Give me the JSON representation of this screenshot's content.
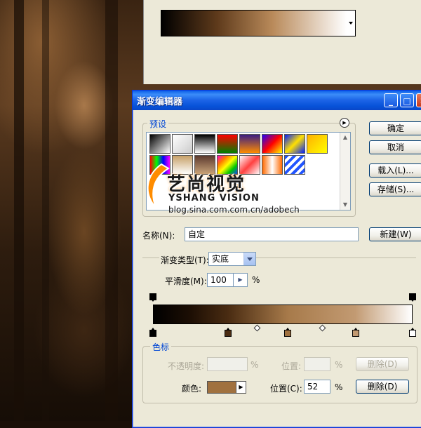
{
  "dialog": {
    "title": "渐变编辑器",
    "controls": {
      "minimize": "_",
      "maximize": "□",
      "close": "✕"
    }
  },
  "presets": {
    "title": "预设",
    "swatches": [
      "linear-gradient(135deg,#000,#fff)",
      "linear-gradient(135deg,#fff 0%,rgba(255,255,255,0) 100%)",
      "linear-gradient(180deg,#000,#fff)",
      "linear-gradient(180deg,#ff0000,#008000)",
      "linear-gradient(180deg,#3a1d84,#ff8c00)",
      "linear-gradient(135deg,#1e00ff,#ff0000,#ffff00)",
      "linear-gradient(135deg,#001eff,#ffe000,#001eff)",
      "linear-gradient(135deg,#ffb000,#ffff00)",
      "linear-gradient(90deg,#ff0000,#00ff00,#0000ff,#ff00ff)",
      "linear-gradient(180deg,#c6a067,#fff)",
      "linear-gradient(180deg,#5c3a2e,#c8a37a)",
      "linear-gradient(135deg,#ff00c8,#ff7700,#ffff00,#00c800,#0044ff)",
      "linear-gradient(135deg,#ffffff,#ff4040,#ffffff)",
      "linear-gradient(90deg,#ff6a00,#fff,#ff6a00)",
      "repeating-linear-gradient(135deg,#2255ff 0 4px,#fff 4px 8px)"
    ],
    "scroll_up": "▲",
    "scroll_down": "▼"
  },
  "buttons": {
    "ok": "确定",
    "cancel": "取消",
    "load": "载入(L)...",
    "save": "存储(S)...",
    "new": "新建(W)"
  },
  "name": {
    "label": "名称(N):",
    "value": "自定"
  },
  "gradient_type": {
    "title": "渐变类型(T):",
    "value": "实底"
  },
  "smoothness": {
    "label": "平滑度(M):",
    "value": "100",
    "unit": "%"
  },
  "gradient_bar": {
    "opacity_stops": [
      0,
      100
    ],
    "color_stops": [
      {
        "position": 0,
        "color": "#000000"
      },
      {
        "position": 29,
        "color": "#4a2c12"
      },
      {
        "position": 52,
        "color": "#a77a4a"
      },
      {
        "position": 78,
        "color": "#c29a72"
      },
      {
        "position": 100,
        "color": "#ffffff"
      }
    ],
    "midpoints": [
      40,
      65
    ]
  },
  "color_stops_panel": {
    "title": "色标",
    "opacity_label": "不透明度:",
    "opacity_unit": "%",
    "opacity_position_label": "位置:",
    "opacity_position_unit": "%",
    "opacity_delete": "删除(D)",
    "color_label": "颜色:",
    "color_value": "#a0713f",
    "color_position_label": "位置(C):",
    "color_position_value": "52",
    "color_position_unit": "%",
    "color_delete": "删除(D)"
  },
  "watermark": {
    "logo": "艺尚视觉",
    "sub": "YSHANG VISION",
    "url": "blog.sina.com.com.cn/adobech"
  }
}
